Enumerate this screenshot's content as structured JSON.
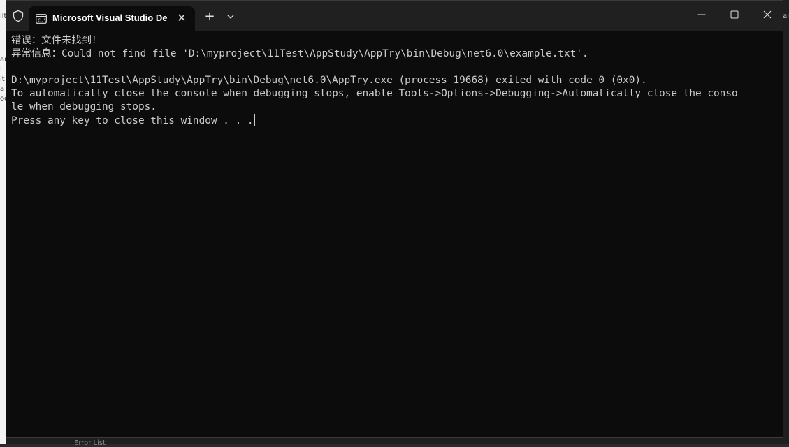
{
  "window": {
    "tab_title": "Microsoft Visual Studio Debug Console"
  },
  "background": {
    "left_fragments": [
      "ilt",
      "ar",
      "i",
      "it",
      "a",
      "oc"
    ],
    "right_fragment": "al",
    "bottom_fragment": "Error List"
  },
  "console": {
    "lines": [
      "错误：文件未找到！",
      "异常信息：Could not find file 'D:\\myproject\\11Test\\AppStudy\\AppTry\\bin\\Debug\\net6.0\\example.txt'.",
      "",
      "D:\\myproject\\11Test\\AppStudy\\AppTry\\bin\\Debug\\net6.0\\AppTry.exe (process 19668) exited with code 0 (0x0).",
      "To automatically close the console when debugging stops, enable Tools->Options->Debugging->Automatically close the conso",
      "le when debugging stops.",
      "Press any key to close this window . . ."
    ]
  },
  "colors": {
    "console_bg": "#0c0c0c",
    "console_fg": "#cccccc",
    "titlebar_bg": "#202020"
  }
}
